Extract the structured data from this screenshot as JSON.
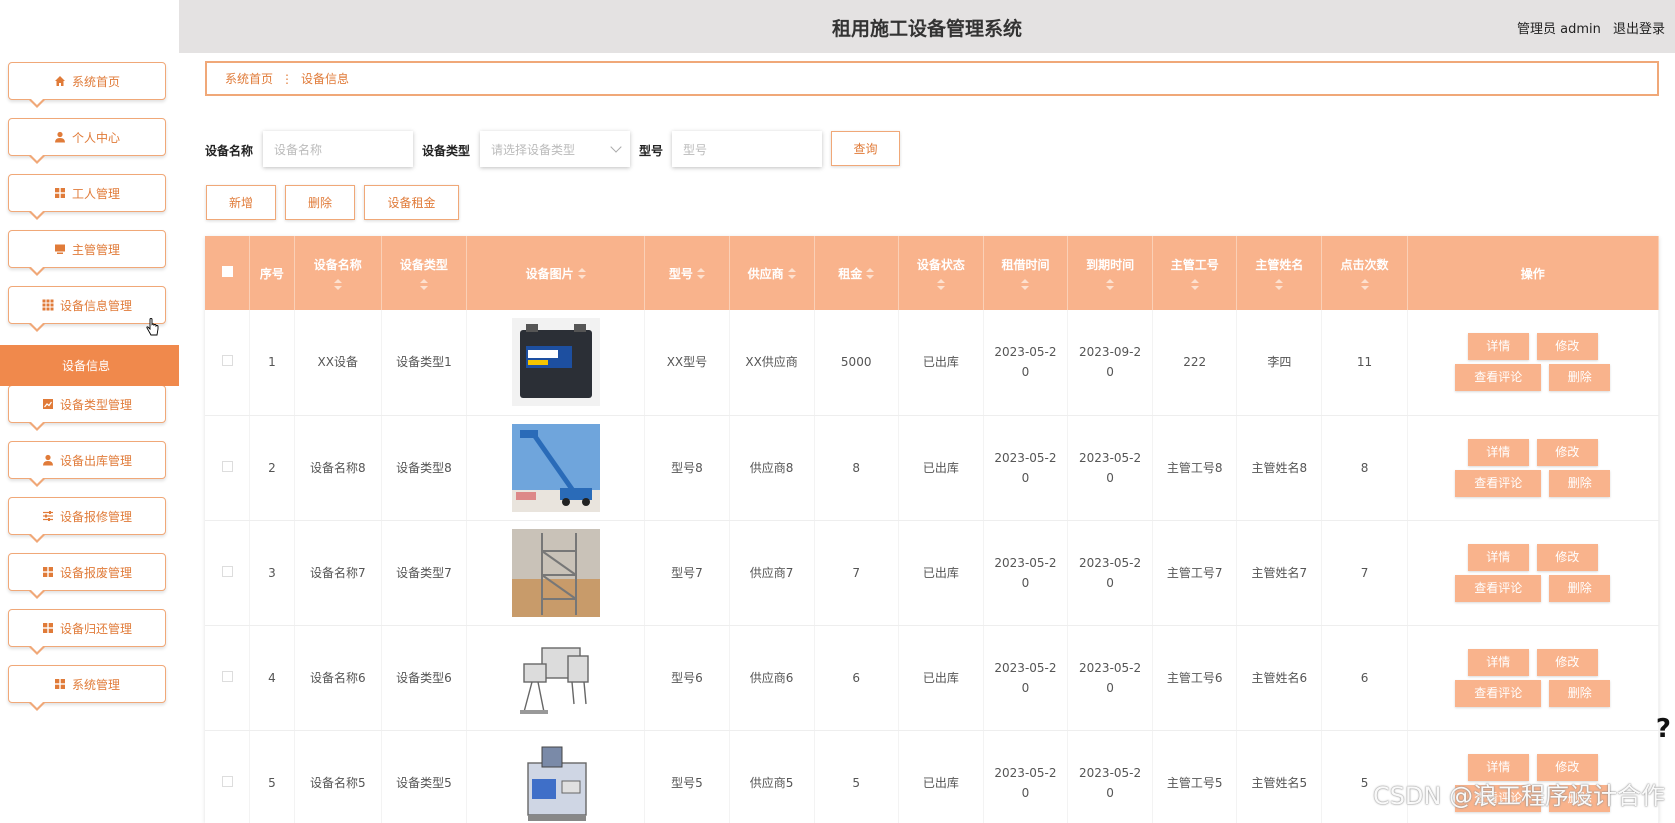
{
  "header": {
    "title": "租用施工设备管理系统",
    "role": "管理员 admin",
    "logout": "退出登录"
  },
  "sidebar": {
    "items": [
      {
        "label": "系统首页",
        "icon": "home-icon"
      },
      {
        "label": "个人中心",
        "icon": "user-icon"
      },
      {
        "label": "工人管理",
        "icon": "grid-icon"
      },
      {
        "label": "主管管理",
        "icon": "monitor-icon"
      },
      {
        "label": "设备信息管理",
        "icon": "apps-icon"
      },
      {
        "label": "设备类型管理",
        "icon": "chart-icon"
      },
      {
        "label": "设备出库管理",
        "icon": "user-icon"
      },
      {
        "label": "设备报修管理",
        "icon": "sliders-icon"
      },
      {
        "label": "设备报废管理",
        "icon": "grid-icon"
      },
      {
        "label": "设备归还管理",
        "icon": "grid-icon"
      },
      {
        "label": "系统管理",
        "icon": "grid-icon"
      }
    ],
    "active_sub": "设备信息"
  },
  "breadcrumb": {
    "home": "系统首页",
    "separator": "⋮",
    "current": "设备信息"
  },
  "search": {
    "name_label": "设备名称",
    "name_placeholder": "设备名称",
    "type_label": "设备类型",
    "type_placeholder": "请选择设备类型",
    "model_label": "型号",
    "model_placeholder": "型号",
    "query": "查询"
  },
  "actions": {
    "add": "新增",
    "delete": "删除",
    "rent": "设备租金"
  },
  "table": {
    "headers": [
      "序号",
      "设备名称",
      "设备类型",
      "设备图片",
      "型号",
      "供应商",
      "租金",
      "设备状态",
      "租借时间",
      "到期时间",
      "主管工号",
      "主管姓名",
      "点击次数",
      "操作"
    ],
    "op_labels": {
      "detail": "详情",
      "edit": "修改",
      "comments": "查看评论",
      "delete": "删除"
    },
    "rows": [
      {
        "no": "1",
        "name": "XX设备",
        "type": "设备类型1",
        "image": "battery",
        "model": "XX型号",
        "supplier": "XX供应商",
        "rent": "5000",
        "status": "已出库",
        "rent_time": "2023-05-20",
        "due_time": "2023-09-20",
        "mgr_id": "222",
        "mgr_name": "李四",
        "clicks": "11"
      },
      {
        "no": "2",
        "name": "设备名称8",
        "type": "设备类型8",
        "image": "lift",
        "model": "型号8",
        "supplier": "供应商8",
        "rent": "8",
        "status": "已出库",
        "rent_time": "2023-05-20",
        "due_time": "2023-05-20",
        "mgr_id": "主管工号8",
        "mgr_name": "主管姓名8",
        "clicks": "8"
      },
      {
        "no": "3",
        "name": "设备名称7",
        "type": "设备类型7",
        "image": "scaffold",
        "model": "型号7",
        "supplier": "供应商7",
        "rent": "7",
        "status": "已出库",
        "rent_time": "2023-05-20",
        "due_time": "2023-05-20",
        "mgr_id": "主管工号7",
        "mgr_name": "主管姓名7",
        "clicks": "7"
      },
      {
        "no": "4",
        "name": "设备名称6",
        "type": "设备类型6",
        "image": "machine",
        "model": "型号6",
        "supplier": "供应商6",
        "rent": "6",
        "status": "已出库",
        "rent_time": "2023-05-20",
        "due_time": "2023-05-20",
        "mgr_id": "主管工号6",
        "mgr_name": "主管姓名6",
        "clicks": "6"
      },
      {
        "no": "5",
        "name": "设备名称5",
        "type": "设备类型5",
        "image": "station",
        "model": "型号5",
        "supplier": "供应商5",
        "rent": "5",
        "status": "已出库",
        "rent_time": "2023-05-20",
        "due_time": "2023-05-20",
        "mgr_id": "主管工号5",
        "mgr_name": "主管姓名5",
        "clicks": "5"
      }
    ]
  },
  "watermark": "CSDN @浪工程序设计合作",
  "colors": {
    "accent": "#f0894c",
    "header_bg": "#f9b38c",
    "border": "#f0a878"
  }
}
